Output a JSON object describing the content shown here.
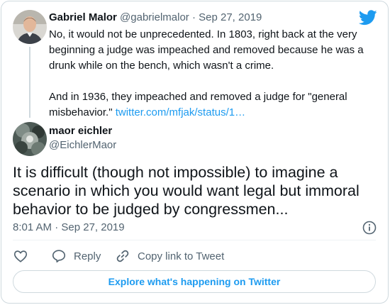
{
  "parent_tweet": {
    "name": "Gabriel Malor",
    "handle": "@gabrielmalor",
    "separator": "·",
    "date": "Sep 27, 2019",
    "paragraph_1": "No, it would not be unprecedented. In 1803, right back at the very beginning a judge was impeached and removed because he was a drunk while on the bench, which wasn't a crime.",
    "paragraph_2_text": "And in 1936, they impeached and removed a judge for \"general misbehavior.\" ",
    "paragraph_2_link": "twitter.com/mfjak/status/1…"
  },
  "main_tweet": {
    "name": "maor eichler",
    "handle": "@EichlerMaor",
    "text": "It is difficult (though not impossible) to imagine a scenario in which you would want legal but immoral behavior to be judged by congressmen...",
    "timestamp": "8:01 AM · Sep 27, 2019"
  },
  "actions": {
    "reply_label": "Reply",
    "copy_link_label": "Copy link to Tweet"
  },
  "explore_label": "Explore what's happening on Twitter",
  "icons": {
    "brand": "twitter-bird-icon",
    "like": "heart-icon",
    "reply": "speech-bubble-icon",
    "copy": "link-icon",
    "info": "info-icon"
  },
  "colors": {
    "accent": "#1d9bf0",
    "text": "#0f1419",
    "muted": "#536471",
    "border": "#cfd9de"
  }
}
